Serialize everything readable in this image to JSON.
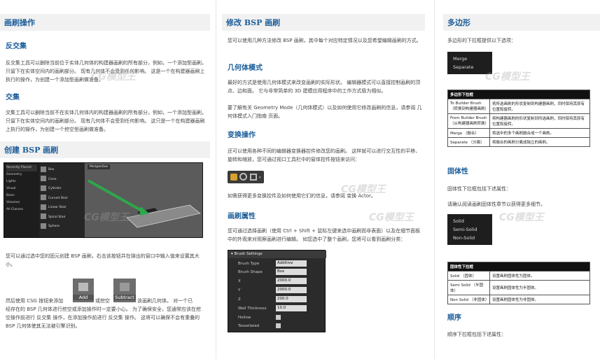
{
  "col1": {
    "header": "画刷操作",
    "inverse_title": "反交集",
    "inverse_text": "反交集工具可以删除当前位于实体几何体的构建器画刷的所有部分，例如，一个添加型画刷，只留下在实体空间内的画刷部分。 现有几何体不会受到任何影响。 这是一个在构建器画刷上执行的操作，为创建一个添加型画刷做准备。",
    "intersect_title": "交集",
    "intersect_text": "交集工具可以删除当前不在实体几何体内的构建器画刷的所有部分，例如，一个添加型画刷，只留下在实体空间内的画刷部分。 现有几何体不会受到任何影响。 这只是一个在构建器画刷上执行的操作，为创建一个挖空型画刷做准备。",
    "create_header": "创建 BSP 画刷",
    "create_text1": "您可以通过选中您的固元创建 BSP 画刷，右击该按钮并在弹出的窗口中输入值来设置其大小。",
    "create_text2_a": "然后使用 CSG 按钮来添加",
    "create_text2_b": "或挖空",
    "create_text2_c": "该画刷几何体。 对一个已",
    "create_text3": "经存在的 BSP 几何体进行挖空或添加操作时一定要小心。 为了确保安全，您通常应该在挖空操作前进行 反交集 操作，在添加操作前进行 反交集 操作。 这将可以确保不会有重叠的 BSP 几何体使其无法被引擎识别。",
    "add_label": "Add",
    "subtract_label": "Subtract",
    "editor_menu": [
      "Recently Placed",
      "Geometry",
      "Lights",
      "Visual",
      "Basic",
      "Volumes",
      "All Classes"
    ],
    "editor_items": [
      "Box",
      "Cone",
      "Cylinder",
      "Curved Stair",
      "Linear Stair",
      "Spiral Stair",
      "Sphere"
    ],
    "editor_viewport": "Perspective"
  },
  "col2": {
    "header": "修改 BSP 画刷",
    "intro": "您可以使用几种方法修改 BSP 画刷，其中每个对应特定情况以及您希望编辑画刷的方式。",
    "geom_title": "几何体模式",
    "geom_text": "最好的方式是使用几何体模式来改变画刷的实际形状。 编辑器模式可以直接控制画刷的顶点、边和面。 它与非常简单的 3D 建模应用程序中的工作方式极为相似。",
    "geom_text2": "要了解有关 Geometry Mode（几何体模式）以及如何使用它修改画刷的信息，请参阅 几何体模式入门指南 页面。",
    "xform_title": "变换操作",
    "xform_text": "还可以使用各种不同的编辑器变换器控件修改您的画刷。 这样就可以进行交互性的平移、旋转和缩放，您可通过视口工具栏中的窗体控件按钮来访问：",
    "xform_text2": "如需获得更多变换控件及如何使用它们的信息，请参阅 变换 Actor。",
    "props_title": "画刷属性",
    "props_text": "您可通过选择画刷（使用 Ctrl + Shift + 鼠标左键来选中画刷而非表面）以及在细节面板中的外观来对观察画刷进行编辑。 如您选中了整个画刷，您将可以看到画刷分类：",
    "brush_panel": {
      "title": "Brush Settings",
      "rows": [
        {
          "label": "Brush Type",
          "value": "Additive"
        },
        {
          "label": "Brush Shape",
          "value": "Box"
        },
        {
          "label": "X",
          "value": "2000.0"
        },
        {
          "label": "Y",
          "value": "2000.0"
        },
        {
          "label": "Z",
          "value": "200.0"
        },
        {
          "label": "Wall Thickness",
          "value": "10.0"
        },
        {
          "label": "Hollow",
          "value": ""
        },
        {
          "label": "Tessellated",
          "value": ""
        }
      ]
    }
  },
  "col3": {
    "poly_header": "多边形",
    "poly_text": "多边形的下拉框提供以下选项：",
    "poly_menu": [
      "Merge",
      "Separate"
    ],
    "poly_table_head": "多边形下拉框",
    "poly_table": [
      [
        "To Builder Brush （转换到构建器画刷）",
        "将所选画刷的形状复制到构建器画刷，同时保持其原有位置和旋转。"
      ],
      [
        "From Builder Brush （从构建器画刷转换）",
        "将构建器画刷的形状复制到所选画刷，同时保持其原有位置和旋转。"
      ],
      [
        "Merge （融合）",
        "将选中的多个画刷融合成一个画刷。"
      ],
      [
        "Separate （分离）",
        "将融合的画刷分离成独立的画刷。"
      ]
    ],
    "solid_header": "固体性",
    "solid_text": "固体性下拉框包括下述属性：",
    "solid_text2": "请确认阅读画刷固体性章节以获得更多细节。",
    "solid_menu": [
      "Solid",
      "Semi-Solid",
      "Non-Solid"
    ],
    "solid_table_head": "固体性下拉框",
    "solid_table": [
      [
        "Solid （固体）",
        "设置画刷固体性为固体。"
      ],
      [
        "Semi Solid （半固体）",
        "设置画刷固体性为半固体。"
      ],
      [
        "Non Solid （非固体）",
        "设置画刷固体性为非固体。"
      ]
    ],
    "order_header": "顺序",
    "order_text": "顺序下拉框包括下述属性："
  },
  "watermark": "CG模型王"
}
